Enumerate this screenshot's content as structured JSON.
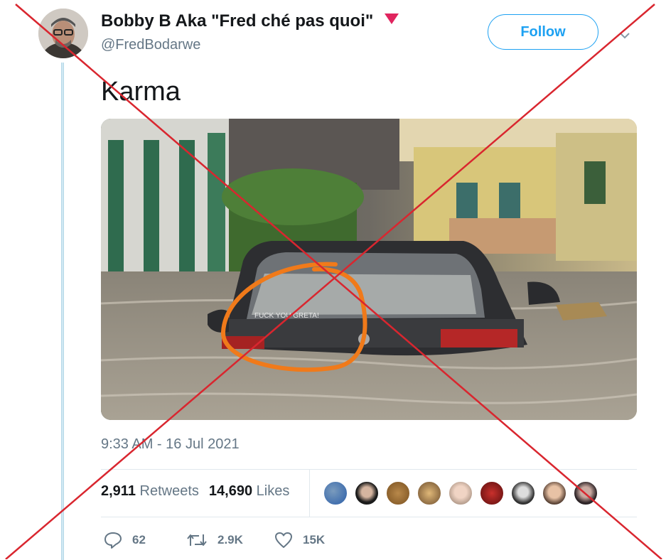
{
  "tweet": {
    "display_name": "Bobby B Aka \"Fred ché pas quoi\"",
    "handle": "@FredBodarwe",
    "follow_label": "Follow",
    "text": "Karma",
    "media_caption_on_car": "FUCK YOU GRETA!",
    "timestamp": "9:33 AM - 16 Jul 2021"
  },
  "stats": {
    "retweets_count": "2,911",
    "retweets_label": "Retweets",
    "likes_count": "14,690",
    "likes_label": "Likes"
  },
  "actions": {
    "reply_count": "62",
    "retweet_count": "2.9K",
    "like_count": "15K"
  },
  "colors": {
    "accent": "#1da1f2",
    "cross": "#d9262f",
    "annotation": "#f07a1a",
    "verified_heart": "#e0245e"
  },
  "icons": [
    "reply-icon",
    "retweet-icon",
    "heart-icon",
    "chevron-down-icon"
  ]
}
